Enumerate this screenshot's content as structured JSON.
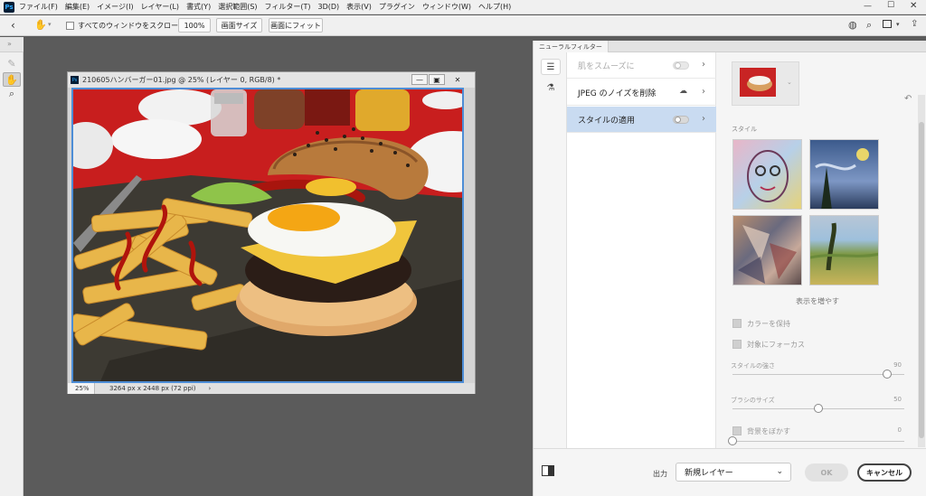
{
  "menubar": {
    "items": [
      "ファイル(F)",
      "編集(E)",
      "イメージ(I)",
      "レイヤー(L)",
      "書式(Y)",
      "選択範囲(S)",
      "フィルター(T)",
      "3D(D)",
      "表示(V)",
      "プラグイン",
      "ウィンドウ(W)",
      "ヘルプ(H)"
    ]
  },
  "options": {
    "scroll_all_label": "すべてのウィンドウをスクロール",
    "zoom_100": "100%",
    "fit_screen": "画面サイズ",
    "fill_screen": "画面にフィット"
  },
  "document": {
    "title": "210605ハンバーガー01.jpg @ 25% (レイヤー 0, RGB/8) *",
    "zoom": "25%",
    "dimensions": "3264 px x 2448 px (72 ppi)"
  },
  "panel": {
    "tab_label": "ニューラルフィルター",
    "filters": [
      {
        "label": "肌をスムーズに"
      },
      {
        "label": "JPEG のノイズを削除"
      },
      {
        "label": "スタイルの適用"
      }
    ],
    "style_label": "スタイル",
    "show_more": "表示を増やす",
    "checkboxes": [
      "カラーを保持",
      "対象にフォーカス"
    ],
    "sliders": [
      {
        "label": "スタイルの強さ",
        "value": "90",
        "level": 0.9
      },
      {
        "label": "ブラシのサイズ",
        "value": "50",
        "level": 0.5
      },
      {
        "label": "背景をぼかす",
        "value": "0",
        "level": 0.0
      }
    ],
    "output_label": "出力",
    "output_value": "新規レイヤー",
    "ok_label": "OK",
    "cancel_label": "キャンセル"
  },
  "colors": {
    "accent": "#c9dbf1",
    "selection_border": "#4d8dd6"
  }
}
